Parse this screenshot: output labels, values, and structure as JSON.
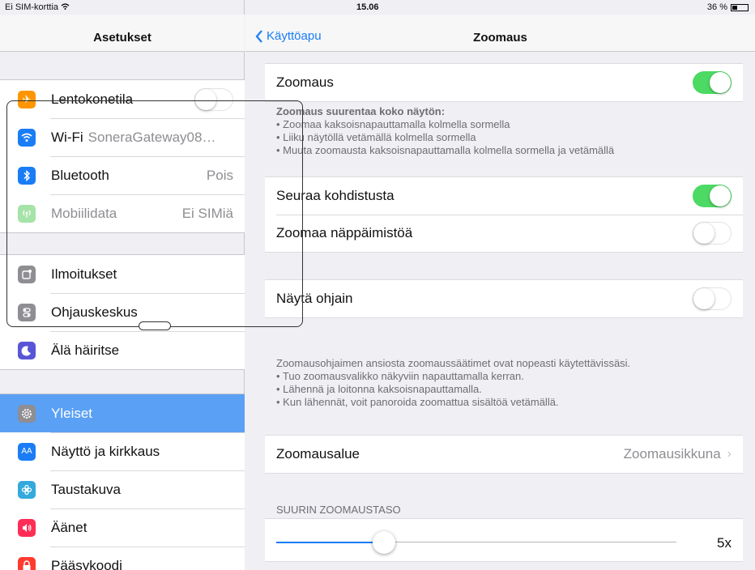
{
  "status_bar": {
    "carrier": "Ei SIM-korttia",
    "time": "15.06",
    "battery": "36 %",
    "battery_level": 0.36
  },
  "sidebar": {
    "title": "Asetukset",
    "groups": [
      {
        "items": [
          {
            "label": "Lentokonetila",
            "icon": "airplane-icon",
            "color": "#ff9500",
            "glyph": "✈",
            "toggle": "off"
          },
          {
            "label": "Wi-Fi",
            "value": "SoneraGateway08…",
            "icon": "wifi-icon",
            "color": "#1a7df6",
            "glyph": "≋"
          },
          {
            "label": "Bluetooth",
            "value": "Pois",
            "icon": "bluetooth-icon",
            "color": "#1a7df6",
            "glyph": "ᛒ"
          },
          {
            "label": "Mobiilidata",
            "value": "Ei SIMiä",
            "icon": "cellular-icon",
            "color": "#a6e3a8",
            "glyph": "◉"
          }
        ]
      },
      {
        "items": [
          {
            "label": "Ilmoitukset",
            "icon": "notifications-icon",
            "color": "#8e8e93",
            "glyph": "▢"
          },
          {
            "label": "Ohjauskeskus",
            "icon": "control-center-icon",
            "color": "#8e8e93",
            "glyph": "☰"
          },
          {
            "label": "Älä häiritse",
            "icon": "moon-icon",
            "color": "#5856d6",
            "glyph": "☾"
          }
        ]
      },
      {
        "items": [
          {
            "label": "Yleiset",
            "icon": "gear-icon",
            "color": "#8e8e93",
            "glyph": "⚙",
            "selected": true
          },
          {
            "label": "Näyttö ja kirkkaus",
            "icon": "display-icon",
            "color": "#1a7df6",
            "glyph": "AA"
          },
          {
            "label": "Taustakuva",
            "icon": "wallpaper-icon",
            "color": "#34aadc",
            "glyph": "❀"
          },
          {
            "label": "Äänet",
            "icon": "speaker-icon",
            "color": "#ff2d55",
            "glyph": "◀"
          },
          {
            "label": "Pääsykoodi",
            "icon": "lock-icon",
            "color": "#ff3b30",
            "glyph": "🔒"
          }
        ]
      }
    ]
  },
  "detail": {
    "back_label": "Käyttöapu",
    "title": "Zoomaus",
    "zoom_row": {
      "label": "Zoomaus",
      "toggle": "on"
    },
    "zoom_footer": {
      "heading": "Zoomaus suurentaa koko näytön:",
      "lines": [
        "• Zoomaa kaksoisnapauttamalla kolmella sormella",
        "• Liiku näytöllä vetämällä kolmella sormella",
        "• Muuta zoomausta kaksoisnapauttamalla kolmella sormella ja vetämällä"
      ]
    },
    "follow_focus": {
      "label": "Seuraa kohdistusta",
      "toggle": "on"
    },
    "zoom_keyboard": {
      "label": "Zoomaa näppäimistöä",
      "toggle": "off"
    },
    "show_controller": {
      "label": "Näytä ohjain",
      "toggle": "off"
    },
    "controller_footer": {
      "lines": [
        "Zoomausohjaimen ansiosta zoomaussäätimet ovat nopeasti käytettävissäsi.",
        "• Tuo zoomausvalikko näkyviin napauttamalla kerran.",
        "• Lähennä ja loitonna kaksoisnapauttamalla.",
        "• Kun lähennät, voit panoroida zoomattua sisältöä vetämällä."
      ]
    },
    "zoom_region": {
      "label": "Zoomausalue",
      "value": "Zoomausikkuna",
      "chevron": "›"
    },
    "max_zoom": {
      "header": "SUURIN ZOOMAUSTASO",
      "value": "5x",
      "level": 0.27
    }
  }
}
